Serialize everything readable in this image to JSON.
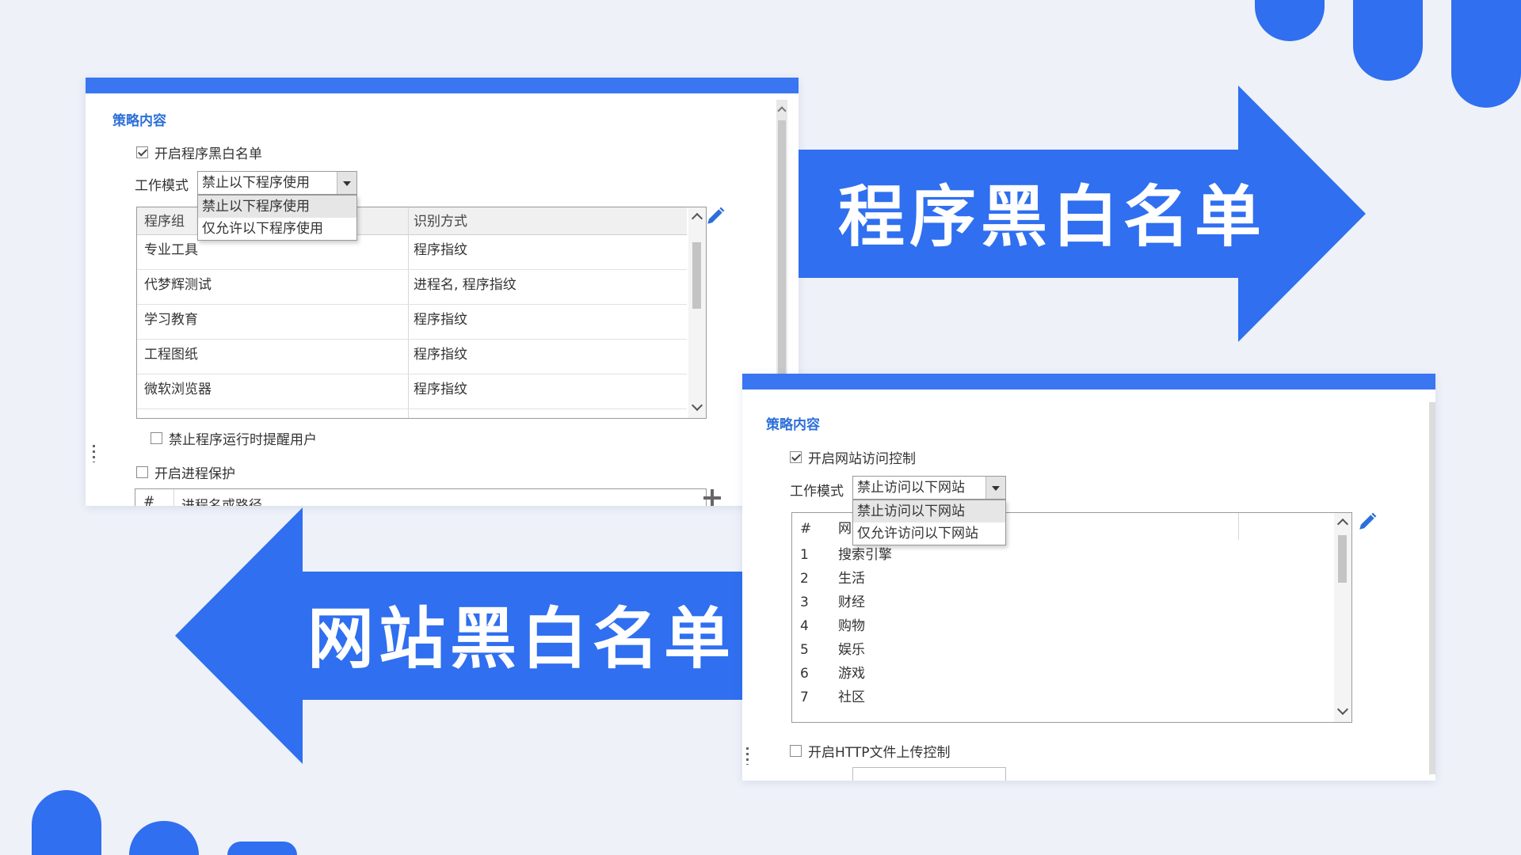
{
  "colors": {
    "accent": "#3a75f2",
    "arrow": "#2f6ff0",
    "section_title": "#2c6fd8"
  },
  "banners": {
    "program": "程序黑白名单",
    "website": "网站黑白名单"
  },
  "program_panel": {
    "section_title": "策略内容",
    "enable_label": "开启程序黑白名单",
    "mode_label": "工作模式",
    "mode_value": "禁止以下程序使用",
    "mode_options": [
      "禁止以下程序使用",
      "仅允许以下程序使用"
    ],
    "columns": [
      "程序组",
      "识别方式"
    ],
    "rows": [
      {
        "group": "专业工具",
        "method": "程序指纹"
      },
      {
        "group": "代梦辉测试",
        "method": "进程名, 程序指纹"
      },
      {
        "group": "学习教育",
        "method": "程序指纹"
      },
      {
        "group": "工程图纸",
        "method": "程序指纹"
      },
      {
        "group": "微软浏览器",
        "method": "程序指纹"
      }
    ],
    "remind_label": "禁止程序运行时提醒用户",
    "process_protect_label": "开启进程保护",
    "process_columns": [
      "#",
      "进程名或路径"
    ]
  },
  "website_panel": {
    "section_title": "策略内容",
    "enable_label": "开启网站访问控制",
    "mode_label": "工作模式",
    "mode_value": "禁止访问以下网站",
    "mode_options": [
      "禁止访问以下网站",
      "仅允许访问以下网站"
    ],
    "columns": [
      "#",
      "网"
    ],
    "rows": [
      {
        "no": "1",
        "name": "搜索引擎"
      },
      {
        "no": "2",
        "name": "生活"
      },
      {
        "no": "3",
        "name": "财经"
      },
      {
        "no": "4",
        "name": "购物"
      },
      {
        "no": "5",
        "name": "娱乐"
      },
      {
        "no": "6",
        "name": "游戏"
      },
      {
        "no": "7",
        "name": "社区"
      }
    ],
    "http_upload_label": "开启HTTP文件上传控制"
  }
}
